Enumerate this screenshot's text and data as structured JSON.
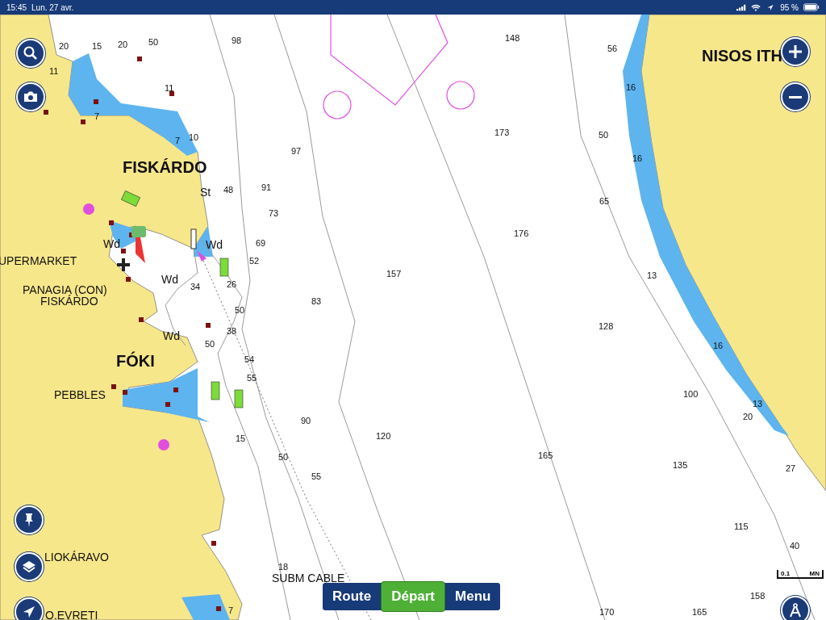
{
  "status_bar": {
    "time": "15:45",
    "date": "Lun. 27 avr.",
    "battery": "95 %"
  },
  "map": {
    "place_names": [
      {
        "text": "FISKÁRDO",
        "kind": "town"
      },
      {
        "text": "FÓKI",
        "kind": "town"
      },
      {
        "text": "UPERMARKET",
        "kind": "place"
      },
      {
        "text": "PANAGIA (CON)",
        "kind": "place"
      },
      {
        "text": "FISKÁRDO",
        "kind": "place"
      },
      {
        "text": "PEBBLES",
        "kind": "place"
      },
      {
        "text": "LIOKÁRAVO",
        "kind": "place"
      },
      {
        "text": "O.EVRETI",
        "kind": "place"
      },
      {
        "text": "NISOS ITH",
        "kind": "town"
      },
      {
        "text": "SUBM CABLE",
        "kind": "place"
      }
    ],
    "seabed_marks": [
      "St",
      "Wd",
      "Wd",
      "Wd",
      "Wd"
    ],
    "soundings": [
      "20",
      "15",
      "20",
      "50",
      "98",
      "148",
      "56",
      "11",
      "11",
      "7",
      "7",
      "10",
      "16",
      "173",
      "50",
      "97",
      "16",
      "48",
      "91",
      "73",
      "65",
      "176",
      "69",
      "52",
      "157",
      "13",
      "83",
      "26",
      "34",
      "50",
      "128",
      "38",
      "50",
      "16",
      "54",
      "55",
      "100",
      "90",
      "13",
      "20",
      "120",
      "15",
      "165",
      "50",
      "135",
      "27",
      "55",
      "115",
      "40",
      "18",
      "158",
      "7",
      "170",
      "165"
    ]
  },
  "bottom_bar": [
    {
      "label": "Route",
      "selected": false
    },
    {
      "label": "Départ",
      "selected": true
    },
    {
      "label": "Menu",
      "selected": false
    }
  ],
  "scale": {
    "value": "0.1",
    "unit": "MN"
  }
}
